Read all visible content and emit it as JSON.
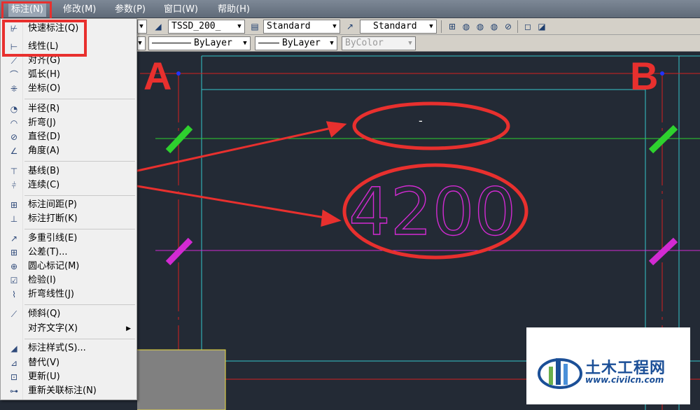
{
  "menubar": {
    "items": [
      {
        "label": "标注(N)"
      },
      {
        "label": "修改(M)"
      },
      {
        "label": "参数(P)"
      },
      {
        "label": "窗口(W)"
      },
      {
        "label": "帮助(H)"
      }
    ]
  },
  "toolbar1": {
    "dimstyle_combo": "TSSD_200_",
    "textstyle_combo": "Standard",
    "tablestyle_combo": "Standard"
  },
  "toolbar2": {
    "linetype_combo": "ByLayer",
    "lineweight_combo": "ByLayer",
    "plotstyle_combo": "ByColor"
  },
  "menu": {
    "items": [
      {
        "label": "快速标注(Q)",
        "icon": "quick-dimension-icon"
      },
      {
        "label": "线性(L)",
        "icon": "linear-dimension-icon"
      },
      {
        "label": "对齐(G)",
        "icon": "aligned-dimension-icon"
      },
      {
        "label": "弧长(H)",
        "icon": "arc-length-icon"
      },
      {
        "label": "坐标(O)",
        "icon": "ordinate-icon"
      },
      {
        "label": "半径(R)",
        "icon": "radius-icon"
      },
      {
        "label": "折弯(J)",
        "icon": "jogged-icon"
      },
      {
        "label": "直径(D)",
        "icon": "diameter-icon"
      },
      {
        "label": "角度(A)",
        "icon": "angular-icon"
      },
      {
        "label": "基线(B)",
        "icon": "baseline-icon"
      },
      {
        "label": "连续(C)",
        "icon": "continue-icon"
      },
      {
        "label": "标注间距(P)",
        "icon": "dimension-space-icon"
      },
      {
        "label": "标注打断(K)",
        "icon": "dimension-break-icon"
      },
      {
        "label": "多重引线(E)",
        "icon": "multileader-icon"
      },
      {
        "label": "公差(T)...",
        "icon": "tolerance-icon"
      },
      {
        "label": "圆心标记(M)",
        "icon": "center-mark-icon"
      },
      {
        "label": "检验(I)",
        "icon": "inspection-icon"
      },
      {
        "label": "折弯线性(J)",
        "icon": "jogged-linear-icon"
      },
      {
        "label": "倾斜(Q)",
        "icon": "oblique-icon"
      },
      {
        "label": "对齐文字(X)",
        "icon": "",
        "submenu": true
      },
      {
        "label": "标注样式(S)...",
        "icon": "dimension-style-icon"
      },
      {
        "label": "替代(V)",
        "icon": "override-icon"
      },
      {
        "label": "更新(U)",
        "icon": "update-icon"
      },
      {
        "label": "重新关联标注(N)",
        "icon": "reassociate-icon"
      }
    ]
  },
  "drawing": {
    "axis_label_a": "A",
    "axis_label_b": "B",
    "dimension_text": "4200",
    "dimension_text_small": "-"
  },
  "watermark": {
    "brand_text": "土木工程网",
    "url": "www.civilcn.com"
  },
  "colors": {
    "canvas_bg": "#232a35",
    "annotation_red": "#e8302e",
    "axis_red": "#d42020",
    "cyan_line": "#35c7cc",
    "green_line": "#2ed12e",
    "magenta_line": "#d22ad2",
    "brand_blue": "#1b4f97"
  }
}
